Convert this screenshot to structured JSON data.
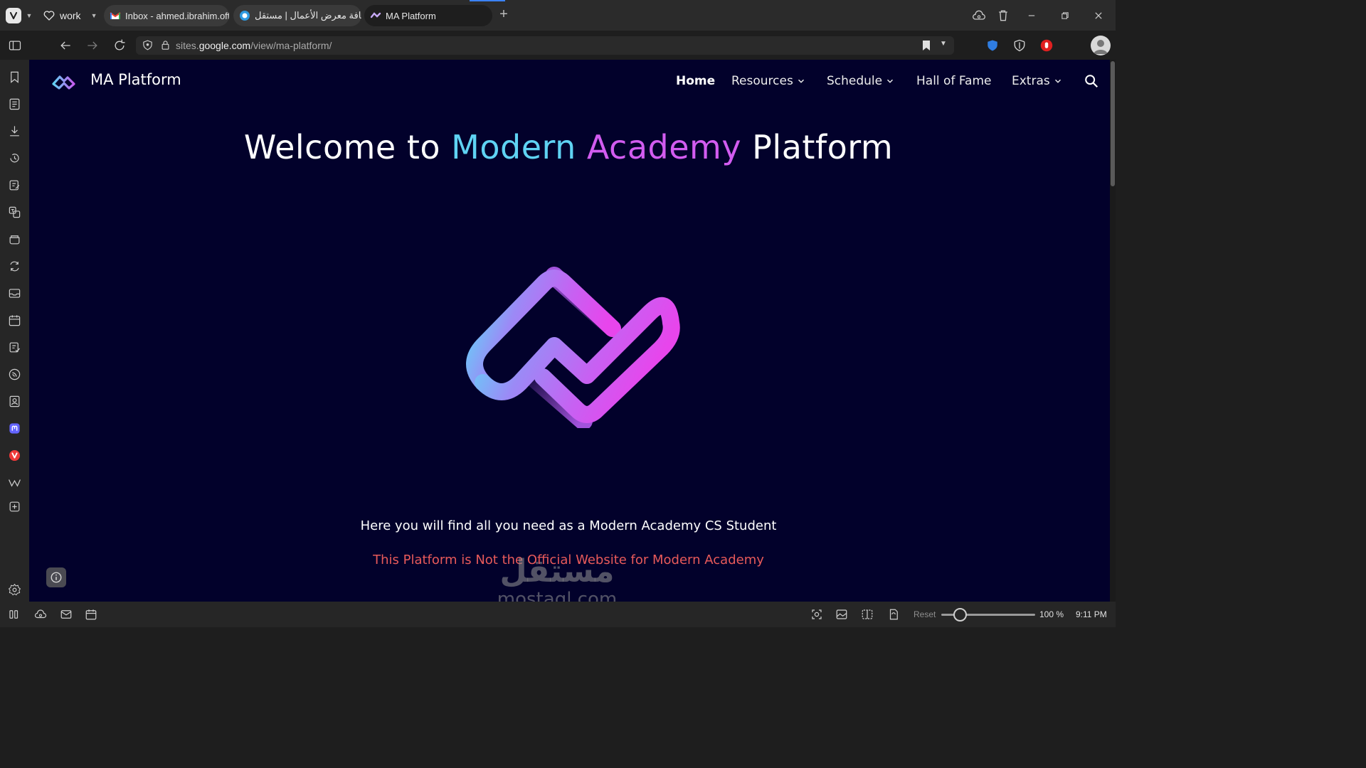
{
  "browser": {
    "workspace": "work",
    "tabs": [
      {
        "title": "Inbox - ahmed.ibrahim.offic",
        "favicon": "gmail-icon",
        "active": false
      },
      {
        "title": "إضافة معرض الأعمال | مستقل",
        "favicon": "mostaql-icon",
        "active": false
      },
      {
        "title": "MA Platform",
        "favicon": "ma-platform-icon",
        "active": true
      }
    ],
    "url": {
      "prefix": "sites.",
      "domain": "google.com",
      "path": "/view/ma-platform/"
    },
    "accent_color": "#3b82f6"
  },
  "site": {
    "name": "MA Platform",
    "nav": [
      {
        "label": "Home",
        "has_dropdown": false,
        "active": true
      },
      {
        "label": "Resources",
        "has_dropdown": true
      },
      {
        "label": "Schedule",
        "has_dropdown": true
      },
      {
        "label": "Hall of Fame",
        "has_dropdown": false
      },
      {
        "label": "Extras",
        "has_dropdown": true
      }
    ],
    "hero": {
      "part1": "Welcome to",
      "part2": "Modern",
      "part3": "Academy",
      "part4": "Platform"
    },
    "subtitle": "Here you will find all you need as a Modern Academy CS Student",
    "warning": "This Platform is Not the Official Website for Modern Academy",
    "colors": {
      "background": "#02012b",
      "cyan": "#5fd3f3",
      "magenta": "#d25cf0",
      "warning": "#e85a5a"
    }
  },
  "watermark": {
    "arabic": "مستقل",
    "latin": "mostaql.com"
  },
  "statusbar": {
    "reset_label": "Reset",
    "zoom": "100 %",
    "zoom_level": 1.0,
    "time": "9:11 PM"
  }
}
